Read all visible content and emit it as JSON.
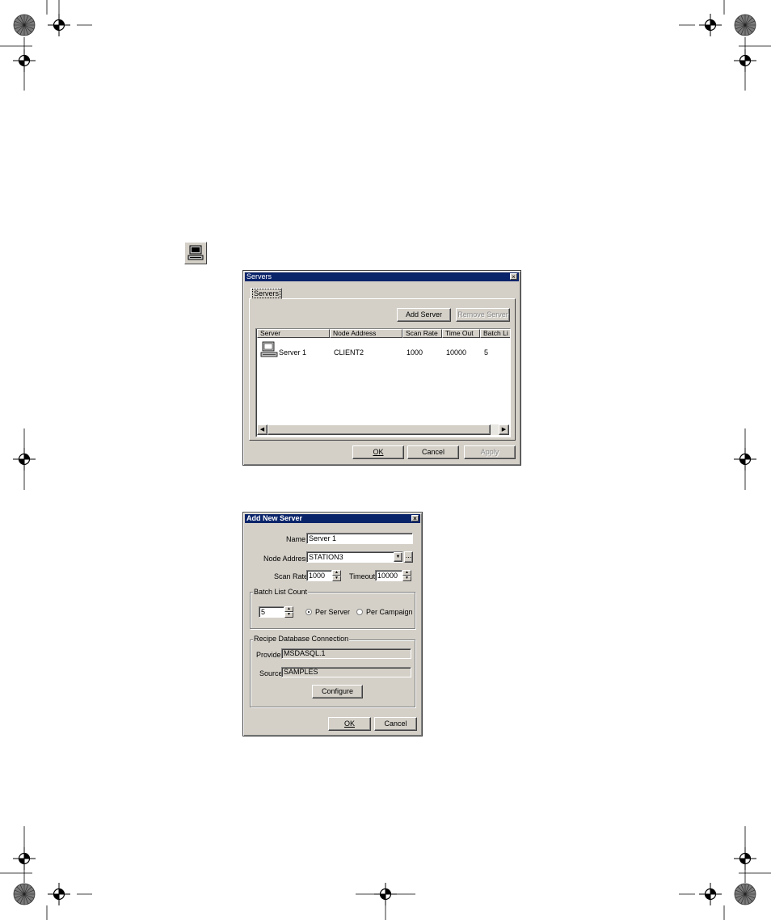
{
  "servers_dialog": {
    "title": "Servers",
    "close": "×",
    "tab": "Servers",
    "add_server": "Add Server",
    "remove_server": "Remove Server",
    "columns": [
      "Server",
      "Node Address",
      "Scan Rate",
      "Time Out",
      "Batch Li"
    ],
    "rows": [
      {
        "server": "Server 1",
        "node_address": "CLIENT2",
        "scan_rate": "1000",
        "time_out": "10000",
        "batch": "5"
      }
    ],
    "ok": "OK",
    "cancel": "Cancel",
    "apply": "Apply"
  },
  "add_new_server": {
    "title": "Add New Server",
    "close": "×",
    "name_label": "Name",
    "name_value": "Server 1",
    "node_address_label": "Node Address",
    "node_address_value": "STATION3",
    "browse": "...",
    "scan_rate_label": "Scan Rate",
    "scan_rate_value": "1000",
    "timeout_label": "Timeout",
    "timeout_value": "10000",
    "batch_group": "Batch List Count",
    "batch_value": "5",
    "per_server": "Per Server",
    "per_campaign": "Per Campaign",
    "recipe_group": "Recipe Database Connection",
    "provider_label": "Provider",
    "provider_value": "MSDASQL.1",
    "source_label": "Source",
    "source_value": "SAMPLES",
    "configure": "Configure",
    "ok": "OK",
    "cancel": "Cancel"
  },
  "icons": [
    "registration-mark-icon",
    "color-wheel-icon",
    "server-computer-icon",
    "scroll-left-icon",
    "scroll-right-icon",
    "dropdown-arrow-icon",
    "spin-up-icon",
    "spin-down-icon"
  ]
}
